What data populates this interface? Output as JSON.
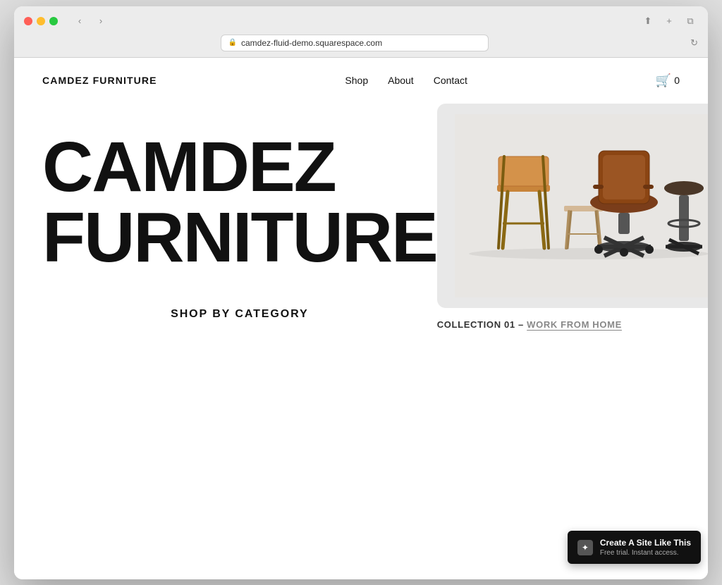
{
  "browser": {
    "url": "camdez-fluid-demo.squarespace.com",
    "url_prefix": "🔒",
    "back_label": "‹",
    "forward_label": "›",
    "refresh_label": "↻",
    "share_label": "⬆",
    "new_tab_label": "+",
    "duplicate_label": "❐"
  },
  "header": {
    "logo": "CAMDEZ FURNITURE",
    "nav": {
      "shop": "Shop",
      "about": "About",
      "contact": "Contact"
    },
    "cart_count": "0"
  },
  "hero": {
    "collection_label_prefix": "COLLECTION 01 – ",
    "collection_link": "WORK FROM HOME"
  },
  "big_heading": "CAMDEZ FURNITURE",
  "shop_category": {
    "title": "SHOP BY CATEGORY"
  },
  "squarespace_badge": {
    "main": "Create A Site Like This",
    "sub": "Free trial. Instant access."
  }
}
